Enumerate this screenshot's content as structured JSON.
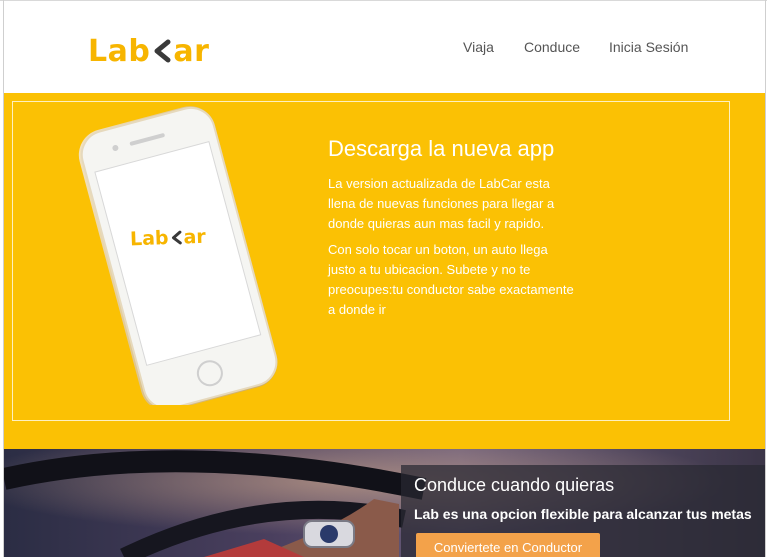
{
  "brand": {
    "logo_left": "Lab",
    "logo_right": "ar",
    "accent": "#fbc104"
  },
  "nav": {
    "items": [
      "Viaja",
      "Conduce",
      "Inicia Sesión"
    ]
  },
  "hero": {
    "title": "Descarga la nueva app",
    "paragraph1": "La version actualizada de LabCar esta llena de nuevas funciones para llegar a donde quieras aun mas facil y rapido.",
    "paragraph2": "Con solo tocar un boton, un auto llega justo a tu ubicacion. Subete y no te preocupes:tu conductor sabe exactamente a donde ir",
    "phone_logo_left": "Lab",
    "phone_logo_right": "ar"
  },
  "drive": {
    "title": "Conduce cuando quieras",
    "subtitle": "Lab es una opcion flexible para alcanzar tus metas",
    "button_label": "Conviertete en Conductor",
    "button_color": "#f3a24a"
  }
}
